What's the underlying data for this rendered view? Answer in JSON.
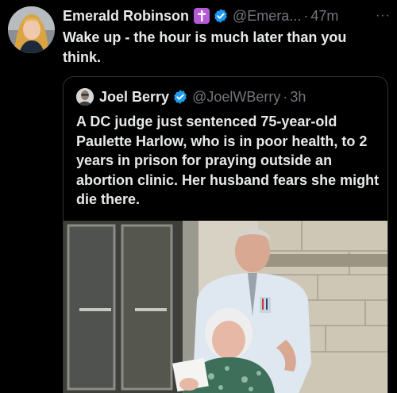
{
  "tweet": {
    "author_name": "Emerald Robinson",
    "badge_icon": "cross-icon",
    "verified_icon": "verified-badge-icon",
    "handle": "@Emera...",
    "separator": "·",
    "time": "47m",
    "more_label": "···",
    "text": "Wake up - the hour is much later than you think."
  },
  "quote": {
    "author_name": "Joel Berry",
    "verified_icon": "verified-badge-icon",
    "handle": "@JoelWBerry",
    "separator": "·",
    "time": "3h",
    "text": "A DC judge just sentenced 75-year-old Paulette Harlow, who is in poor health, to 2 years in prison for praying outside an abortion clinic. Her husband fears she might die there.",
    "photo_icon": "photo-elderly-couple"
  },
  "colors": {
    "background": "#000000",
    "primary_text": "#e7e9ea",
    "secondary_text": "#71767b",
    "verified_blue": "#1d9bf0",
    "badge_purple": "#b65ad6",
    "border": "#2f3336"
  }
}
